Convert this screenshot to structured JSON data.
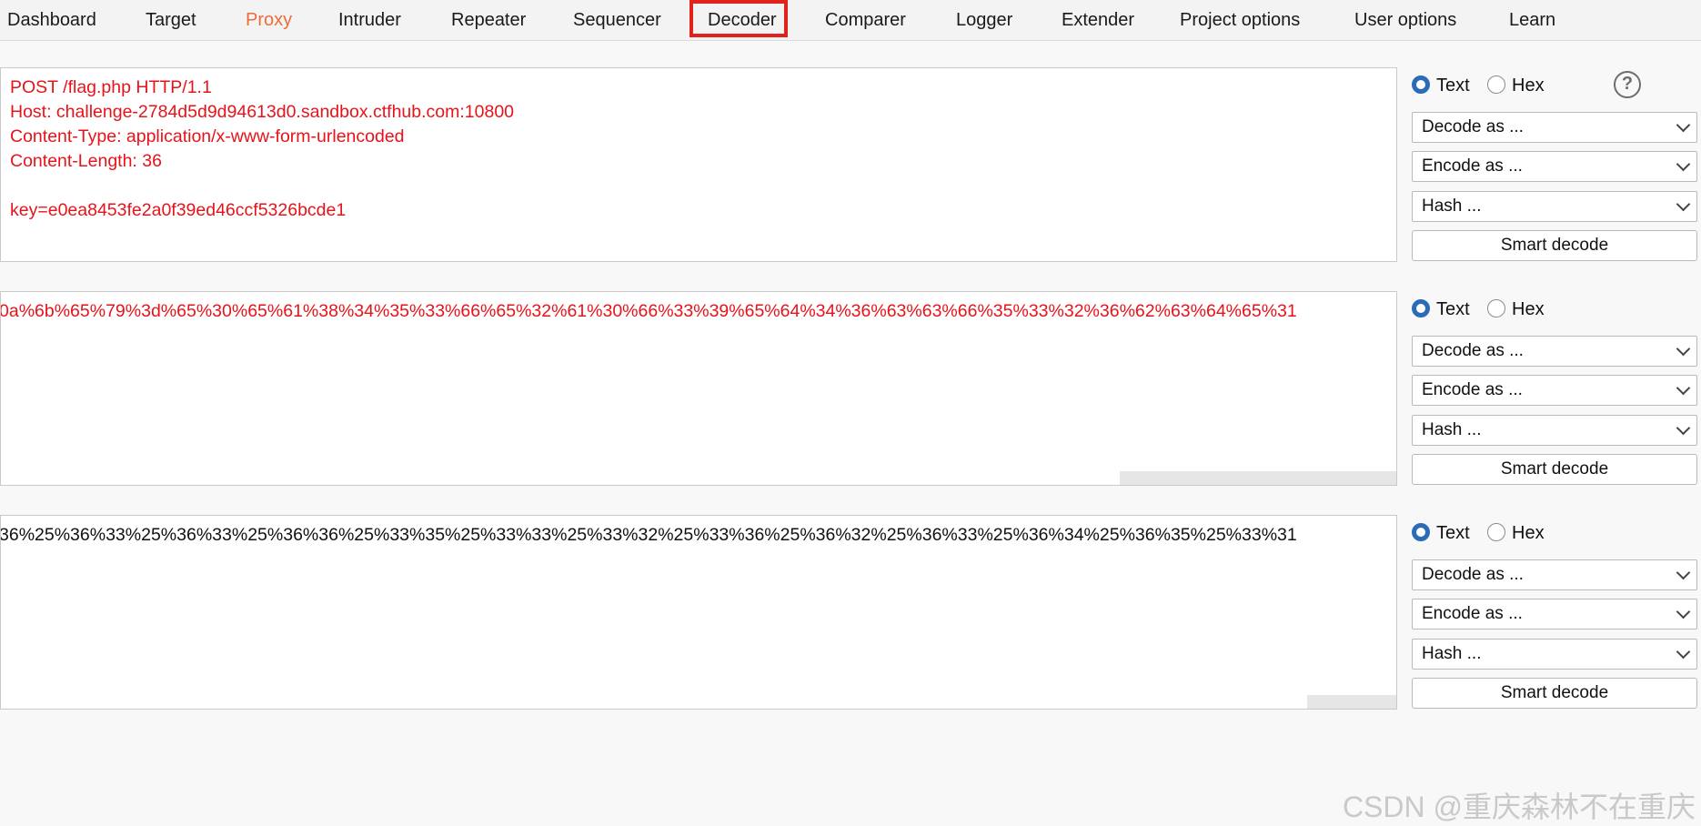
{
  "tabs": [
    {
      "label": "Dashboard"
    },
    {
      "label": "Target"
    },
    {
      "label": "Proxy"
    },
    {
      "label": "Intruder"
    },
    {
      "label": "Repeater"
    },
    {
      "label": "Sequencer"
    },
    {
      "label": "Decoder"
    },
    {
      "label": "Comparer"
    },
    {
      "label": "Logger"
    },
    {
      "label": "Extender"
    },
    {
      "label": "Project options"
    },
    {
      "label": "User options"
    },
    {
      "label": "Learn"
    }
  ],
  "active_tab": "Decoder",
  "colors": {
    "accent": "#ee6b3b",
    "highlight_box": "#e0231c",
    "red_text": "#e8131a",
    "radio": "#2c6bb6"
  },
  "panels": [
    {
      "content": "POST /flag.php HTTP/1.1\nHost: challenge-2784d5d9d94613d0.sandbox.ctfhub.com:10800\nContent-Type: application/x-www-form-urlencoded\nContent-Length: 36\n\nkey=e0ea8453fe2a0f39ed46ccf5326bcde1",
      "text_label": "Text",
      "hex_label": "Hex",
      "selected": "Text",
      "decode_label": "Decode as ...",
      "encode_label": "Encode as ...",
      "hash_label": "Hash ...",
      "smart_label": "Smart decode",
      "help_icon": "?"
    },
    {
      "content": "0a%6b%65%79%3d%65%30%65%61%38%34%35%33%66%65%32%61%30%66%33%39%65%64%34%36%63%63%66%35%33%32%36%62%63%64%65%31",
      "text_label": "Text",
      "hex_label": "Hex",
      "selected": "Text",
      "decode_label": "Decode as ...",
      "encode_label": "Encode as ...",
      "hash_label": "Hash ...",
      "smart_label": "Smart decode"
    },
    {
      "content": "36%25%36%33%25%36%33%25%36%36%25%33%35%25%33%33%25%33%32%25%33%36%25%36%32%25%36%33%25%36%34%25%36%35%25%33%31",
      "text_label": "Text",
      "hex_label": "Hex",
      "selected": "Text",
      "decode_label": "Decode as ...",
      "encode_label": "Encode as ...",
      "hash_label": "Hash ...",
      "smart_label": "Smart decode"
    }
  ],
  "watermark": "CSDN @重庆森林不在重庆"
}
